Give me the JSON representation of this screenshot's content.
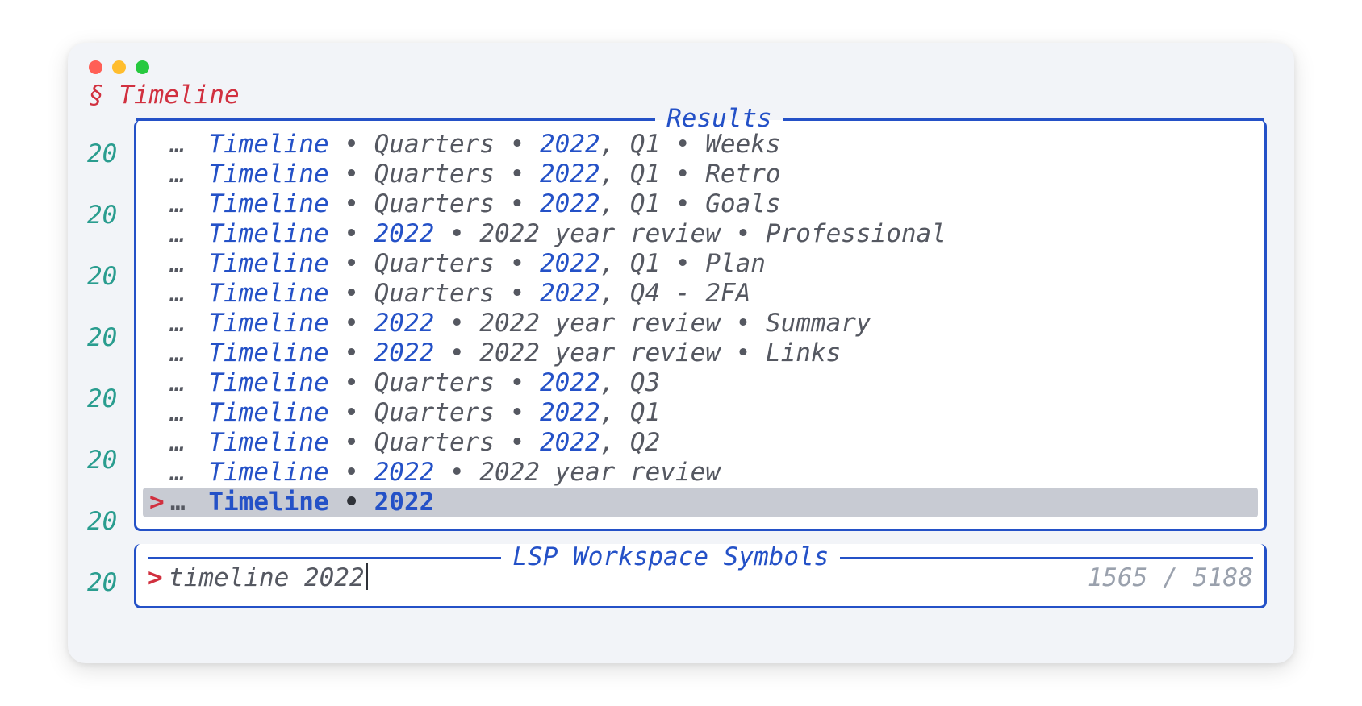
{
  "header": {
    "section_symbol": "§",
    "title": "Timeline"
  },
  "editor_background": {
    "lines": [
      "20",
      "20",
      "20",
      "20",
      "20",
      "20",
      "20",
      "20"
    ],
    "cursor_prefix": "> "
  },
  "results": {
    "title": "Results",
    "ellipsis": "…",
    "bullet": " • ",
    "items": [
      {
        "selected": false,
        "segments": [
          {
            "t": "Timeline",
            "hl": true
          },
          {
            "t": " • ",
            "hl": false
          },
          {
            "t": "Quarters",
            "hl": false
          },
          {
            "t": " • ",
            "hl": false
          },
          {
            "t": "2022",
            "hl": true
          },
          {
            "t": ", Q1",
            "hl": false
          },
          {
            "t": " • ",
            "hl": false
          },
          {
            "t": "Weeks",
            "hl": false
          }
        ]
      },
      {
        "selected": false,
        "segments": [
          {
            "t": "Timeline",
            "hl": true
          },
          {
            "t": " • ",
            "hl": false
          },
          {
            "t": "Quarters",
            "hl": false
          },
          {
            "t": " • ",
            "hl": false
          },
          {
            "t": "2022",
            "hl": true
          },
          {
            "t": ", Q1",
            "hl": false
          },
          {
            "t": " • ",
            "hl": false
          },
          {
            "t": "Retro",
            "hl": false
          }
        ]
      },
      {
        "selected": false,
        "segments": [
          {
            "t": "Timeline",
            "hl": true
          },
          {
            "t": " • ",
            "hl": false
          },
          {
            "t": "Quarters",
            "hl": false
          },
          {
            "t": " • ",
            "hl": false
          },
          {
            "t": "2022",
            "hl": true
          },
          {
            "t": ", Q1",
            "hl": false
          },
          {
            "t": " • ",
            "hl": false
          },
          {
            "t": "Goals",
            "hl": false
          }
        ]
      },
      {
        "selected": false,
        "segments": [
          {
            "t": "Timeline",
            "hl": true
          },
          {
            "t": " • ",
            "hl": false
          },
          {
            "t": "2022",
            "hl": true
          },
          {
            "t": " • ",
            "hl": false
          },
          {
            "t": "2022 year review",
            "hl": false
          },
          {
            "t": " • ",
            "hl": false
          },
          {
            "t": "Professional",
            "hl": false
          }
        ]
      },
      {
        "selected": false,
        "segments": [
          {
            "t": "Timeline",
            "hl": true
          },
          {
            "t": " • ",
            "hl": false
          },
          {
            "t": "Quarters",
            "hl": false
          },
          {
            "t": " • ",
            "hl": false
          },
          {
            "t": "2022",
            "hl": true
          },
          {
            "t": ", Q1",
            "hl": false
          },
          {
            "t": " • ",
            "hl": false
          },
          {
            "t": "Plan",
            "hl": false
          }
        ]
      },
      {
        "selected": false,
        "segments": [
          {
            "t": "Timeline",
            "hl": true
          },
          {
            "t": " • ",
            "hl": false
          },
          {
            "t": "Quarters",
            "hl": false
          },
          {
            "t": " • ",
            "hl": false
          },
          {
            "t": "2022",
            "hl": true
          },
          {
            "t": ", Q4 - 2FA",
            "hl": false
          }
        ]
      },
      {
        "selected": false,
        "segments": [
          {
            "t": "Timeline",
            "hl": true
          },
          {
            "t": " • ",
            "hl": false
          },
          {
            "t": "2022",
            "hl": true
          },
          {
            "t": " • ",
            "hl": false
          },
          {
            "t": "2022 year review",
            "hl": false
          },
          {
            "t": " • ",
            "hl": false
          },
          {
            "t": "Summary",
            "hl": false
          }
        ]
      },
      {
        "selected": false,
        "segments": [
          {
            "t": "Timeline",
            "hl": true
          },
          {
            "t": " • ",
            "hl": false
          },
          {
            "t": "2022",
            "hl": true
          },
          {
            "t": " • ",
            "hl": false
          },
          {
            "t": "2022 year review",
            "hl": false
          },
          {
            "t": " • ",
            "hl": false
          },
          {
            "t": "Links",
            "hl": false
          }
        ]
      },
      {
        "selected": false,
        "segments": [
          {
            "t": "Timeline",
            "hl": true
          },
          {
            "t": " • ",
            "hl": false
          },
          {
            "t": "Quarters",
            "hl": false
          },
          {
            "t": " • ",
            "hl": false
          },
          {
            "t": "2022",
            "hl": true
          },
          {
            "t": ", Q3",
            "hl": false
          }
        ]
      },
      {
        "selected": false,
        "segments": [
          {
            "t": "Timeline",
            "hl": true
          },
          {
            "t": " • ",
            "hl": false
          },
          {
            "t": "Quarters",
            "hl": false
          },
          {
            "t": " • ",
            "hl": false
          },
          {
            "t": "2022",
            "hl": true
          },
          {
            "t": ", Q1",
            "hl": false
          }
        ]
      },
      {
        "selected": false,
        "segments": [
          {
            "t": "Timeline",
            "hl": true
          },
          {
            "t": " • ",
            "hl": false
          },
          {
            "t": "Quarters",
            "hl": false
          },
          {
            "t": " • ",
            "hl": false
          },
          {
            "t": "2022",
            "hl": true
          },
          {
            "t": ", Q2",
            "hl": false
          }
        ]
      },
      {
        "selected": false,
        "segments": [
          {
            "t": "Timeline",
            "hl": true
          },
          {
            "t": " • ",
            "hl": false
          },
          {
            "t": "2022",
            "hl": true
          },
          {
            "t": " • ",
            "hl": false
          },
          {
            "t": "2022 year review",
            "hl": false
          }
        ]
      },
      {
        "selected": true,
        "segments": [
          {
            "t": "Timeline",
            "hl": true
          },
          {
            "t": " • ",
            "hl": false
          },
          {
            "t": "2022",
            "hl": true
          }
        ]
      }
    ]
  },
  "search": {
    "title": "LSP Workspace Symbols",
    "prompt": ">",
    "query": "timeline 2022",
    "count_current": "1565",
    "count_sep": " / ",
    "count_total": "5188"
  }
}
